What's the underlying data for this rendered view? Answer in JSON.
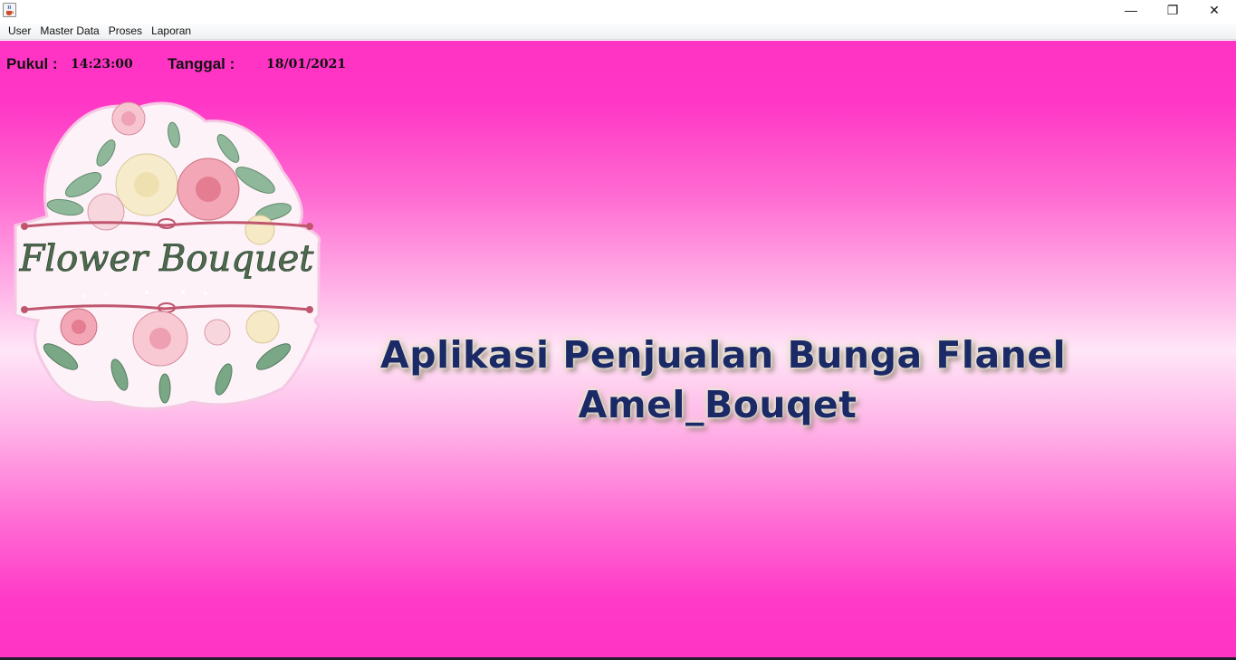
{
  "window": {
    "icon": "java-cup-icon",
    "controls": {
      "minimize": "—",
      "maximize": "❐",
      "close": "✕"
    }
  },
  "menubar": {
    "items": [
      "User",
      "Master Data",
      "Proses",
      "Laporan"
    ]
  },
  "status": {
    "time_label": "Pukul :",
    "time_value": "14:23:00",
    "date_label": "Tanggal :",
    "date_value": "18/01/2021"
  },
  "logo": {
    "text": "Flower Bouquet"
  },
  "headline": {
    "line1": "Aplikasi Penjualan Bunga Flanel",
    "line2": "Amel_Bouqet"
  },
  "colors": {
    "background": "#ff33c4",
    "headline": "#1b2a66"
  }
}
